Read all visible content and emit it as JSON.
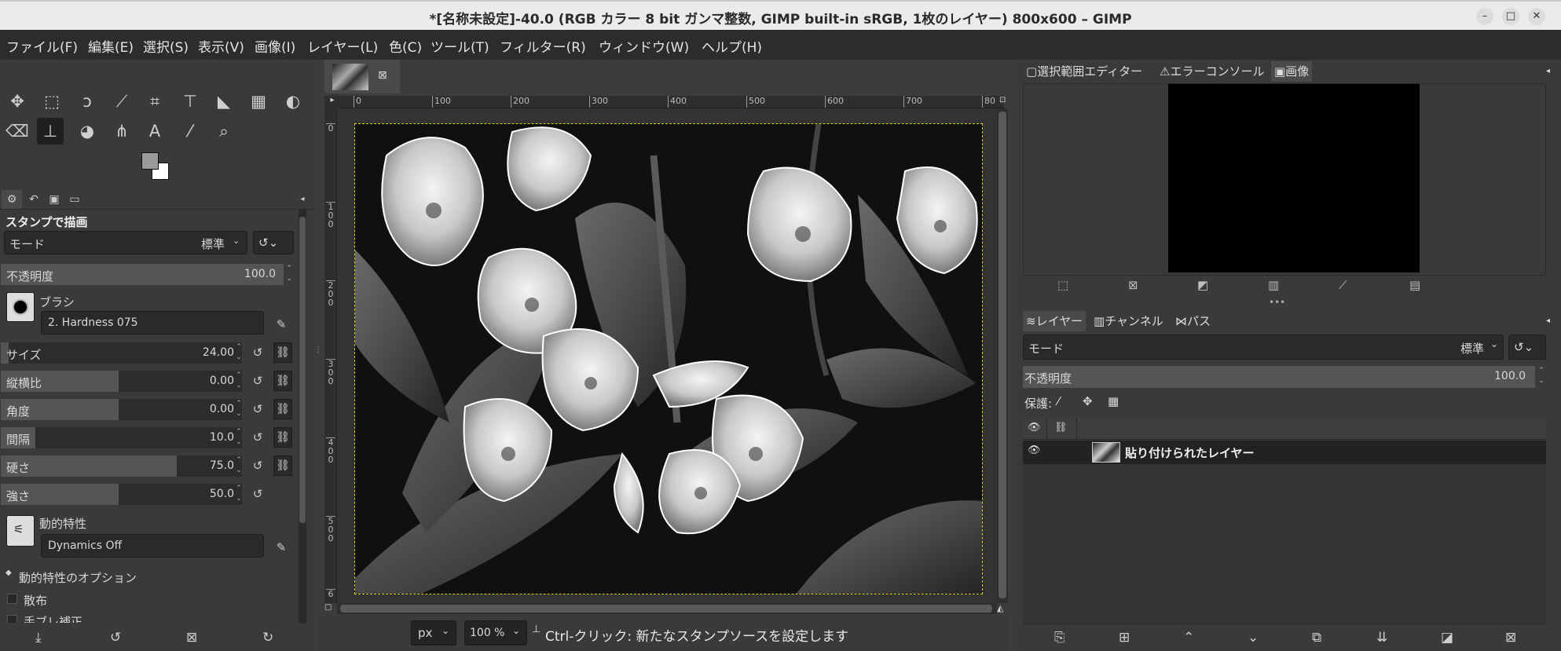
{
  "window": {
    "title": "*[名称未設定]-40.0 (RGB カラー 8 bit ガンマ整数, GIMP built-in sRGB, 1枚のレイヤー) 800x600 – GIMP",
    "minimize": "–",
    "maximize": "□",
    "close": "✕"
  },
  "menu": [
    "ファイル(F)",
    "編集(E)",
    "選択(S)",
    "表示(V)",
    "画像(I)",
    "レイヤー(L)",
    "色(C)",
    "ツール(T)",
    "フィルター(R)",
    "ウィンドウ(W)",
    "ヘルプ(H)"
  ],
  "tool_options": {
    "title": "スタンプで描画",
    "mode_label": "モード",
    "mode_value": "標準",
    "opacity_label": "不透明度",
    "opacity_value": "100.0",
    "opacity_fraction": 1.0,
    "brush_label": "ブラシ",
    "brush_name": "2. Hardness 075",
    "size_label": "サイズ",
    "size_value": "24.00",
    "aspect_label": "縦横比",
    "aspect_value": "0.00",
    "angle_label": "角度",
    "angle_value": "0.00",
    "spacing_label": "間隔",
    "spacing_value": "10.0",
    "hardness_label": "硬さ",
    "hardness_value": "75.0",
    "force_label": "強さ",
    "force_value": "50.0",
    "dynamics_label": "動的特性",
    "dynamics_name": "Dynamics Off",
    "dynamics_options_label": "動的特性のオプション",
    "scatter_label": "散布",
    "smooth_label": "手ブレ補正"
  },
  "canvas": {
    "ruler_labels": [
      "0",
      "100",
      "200",
      "300",
      "400",
      "500",
      "600",
      "700",
      "80"
    ],
    "vruler_labels": [
      "0",
      "1\n0\n0",
      "2\n0\n0",
      "3\n0\n0",
      "4\n0\n0",
      "5\n0\n0",
      "6"
    ],
    "unit": "px",
    "zoom": "100 %",
    "status": "Ctrl-クリック: 新たなスタンプソースを設定します"
  },
  "right_dock": {
    "top_tabs": [
      "選択範囲エディター",
      "エラーコンソール",
      "画像"
    ],
    "layer_tabs": [
      "レイヤー",
      "チャンネル",
      "パス"
    ],
    "mode_label": "モード",
    "mode_value": "標準",
    "opacity_label": "不透明度",
    "opacity_value": "100.0",
    "lock_label": "保護:",
    "layer_name": "貼り付けられたレイヤー"
  },
  "icons": {
    "tools_row1": [
      "move-icon",
      "rect-select-icon",
      "lasso-icon",
      "fuzzy-select-icon",
      "crop-icon",
      "warp-transform-icon",
      "bucket-fill-icon",
      "gradient-icon",
      "smudge-icon"
    ],
    "tools_row2": [
      "eraser-icon",
      "clone-stamp-icon",
      "smudge-blob-icon",
      "paths-icon",
      "text-icon",
      "color-picker-icon",
      "zoom-icon"
    ]
  }
}
